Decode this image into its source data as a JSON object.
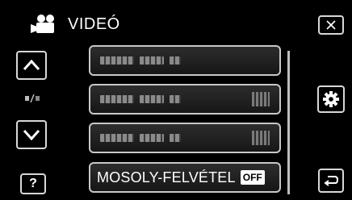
{
  "header": {
    "title": "VIDEÓ",
    "icon": "movie-camera-icon"
  },
  "left_controls": {
    "up_icon": "chevron-up-icon",
    "page_indicator_icon": "page-indicator-icon",
    "down_icon": "chevron-down-icon",
    "help_label": "?"
  },
  "right_controls": {
    "close_icon": "close-icon",
    "settings_icon": "gear-icon",
    "back_icon": "return-icon"
  },
  "menu": {
    "items": [
      {
        "label": "",
        "has_value": false
      },
      {
        "label": "",
        "has_value": true
      },
      {
        "label": "",
        "has_value": true
      },
      {
        "label": "MOSOLY-FELVÉTEL",
        "value": "OFF"
      }
    ]
  },
  "colors": {
    "background": "#000000",
    "border": "#d8d8d8",
    "text": "#ffffff"
  }
}
